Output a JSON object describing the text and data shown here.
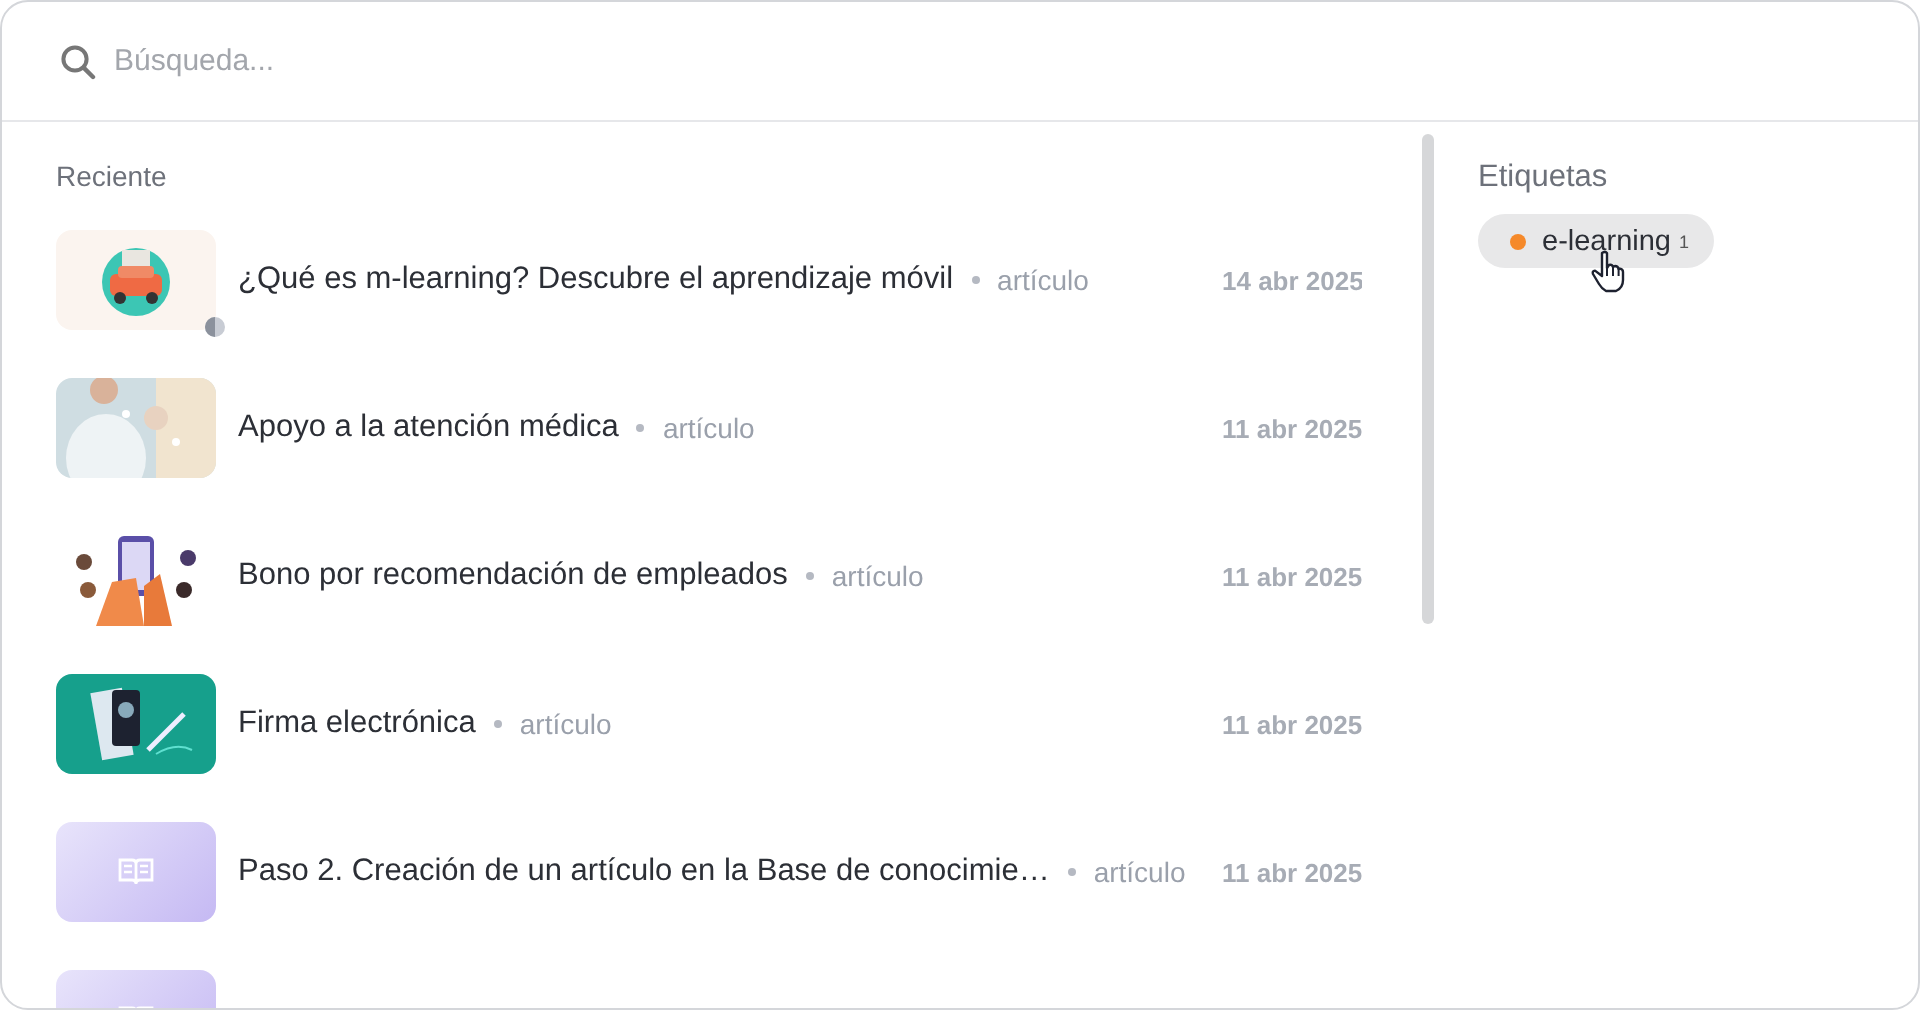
{
  "search": {
    "placeholder": "Búsqueda..."
  },
  "recent": {
    "heading": "Reciente",
    "items": [
      {
        "title": "¿Qué es m-learning? Descubre el aprendizaje móvil",
        "type": "artículo",
        "date": "14 abr 2025",
        "badge": true
      },
      {
        "title": "Apoyo a la atención médica",
        "type": "artículo",
        "date": "11 abr 2025",
        "badge": false
      },
      {
        "title": "Bono por recomendación de empleados",
        "type": "artículo",
        "date": "11 abr 2025",
        "badge": false
      },
      {
        "title": "Firma electrónica",
        "type": "artículo",
        "date": "11 abr 2025",
        "badge": false
      },
      {
        "title": "Paso 2. Creación de un artículo en la Base de conocimie…",
        "type": "artículo",
        "date": "11 abr 2025",
        "thumb": {
          "kind": "placeholder"
        },
        "badge": false
      },
      {
        "thumb": {
          "kind": "placeholder"
        },
        "badge": false
      }
    ]
  },
  "tags": {
    "heading": "Etiquetas",
    "items": [
      {
        "label": "e-learning",
        "count": "1",
        "color": "#f5892a"
      }
    ]
  }
}
